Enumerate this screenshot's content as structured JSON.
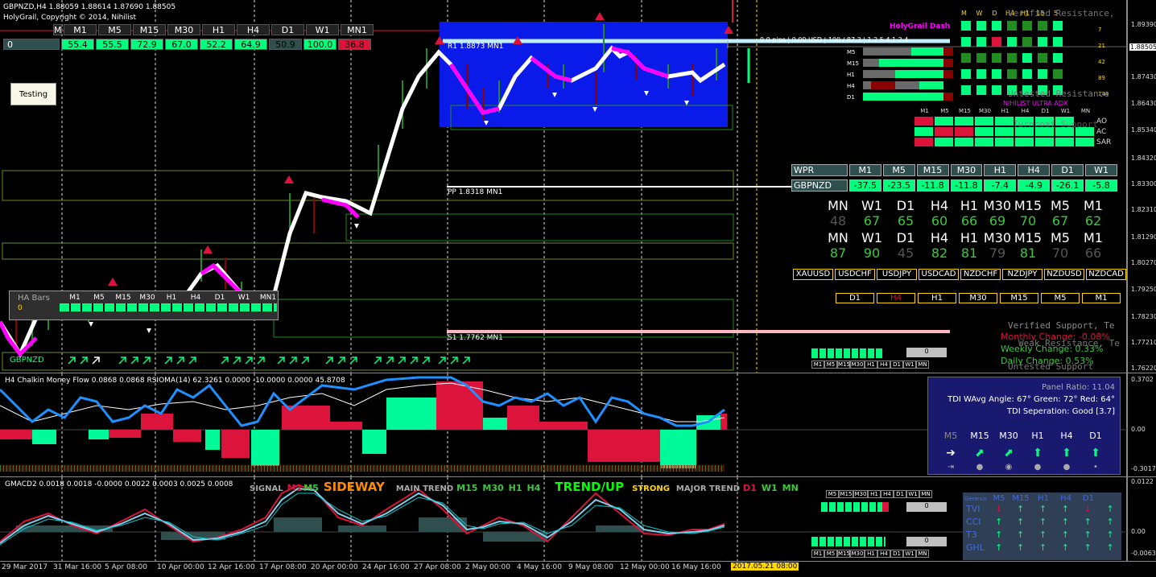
{
  "header": {
    "symbol_line": "GBPNZD,H4  1.88059 1.88614 1.87690 1.88505",
    "copyright": "HolyGrail, Copyright © 2014, Nihilist"
  },
  "tf_labels": [
    "M1",
    "M5",
    "M15",
    "M30",
    "H1",
    "H4",
    "D1",
    "W1",
    "MN1"
  ],
  "tf_bar": {
    "first": "0",
    "values": [
      "55.4",
      "55.5",
      "72.9",
      "67.0",
      "52.2",
      "64.9",
      "50.9",
      "100.0",
      "36.8"
    ]
  },
  "testing_button": "Testing",
  "price_axis": [
    "1.89390",
    "1.88505",
    "1.87430",
    "1.86430",
    "1.85340",
    "1.84320",
    "1.83300",
    "1.82310",
    "1.81290",
    "1.80270",
    "1.79250",
    "1.78230",
    "1.77210",
    "1.76220"
  ],
  "price_highlight": "1.88505",
  "chart_labels": {
    "r1": "R1 1.8873 MN1",
    "pp": "PP 1.8318 MN1",
    "s1": "S1 1.7762 MN1",
    "pips": "0.0 pips | 0.00 USD | 100 / 87.3 | 1.2.5.4.1.2.4"
  },
  "ha": {
    "title": "HA Bars",
    "value": "0",
    "labels": [
      "M1",
      "M5",
      "M15",
      "M30",
      "H1",
      "H4",
      "D1",
      "W1",
      "MN1"
    ]
  },
  "bottom_symbol": "GBPNZD",
  "holygrail": {
    "title": "HolyGrail Dash",
    "cols": [
      "M",
      "W",
      "D",
      "H4",
      "H1",
      "15",
      "5"
    ],
    "rows": [
      "M5",
      "M15",
      "H1",
      "H4",
      "D1"
    ],
    "nums": [
      "7",
      "21",
      "42",
      "89",
      "144"
    ]
  },
  "adx": {
    "title": "NIHILIST ULTRA ADX",
    "cols": [
      "M1",
      "M5",
      "M15",
      "M30",
      "H1",
      "H4",
      "D1",
      "W1",
      "MN"
    ],
    "rows": [
      "AO",
      "AC",
      "SAR"
    ]
  },
  "wpr": {
    "title": "WPR",
    "cols": [
      "M1",
      "M5",
      "M15",
      "M30",
      "H1",
      "H4",
      "D1",
      "W1"
    ],
    "symbol": "GBPNZD",
    "values": [
      "-37.5",
      "-23.5",
      "-11.8",
      "-11.8",
      "-7.4",
      "-4.9",
      "-26.1",
      "-5.8"
    ]
  },
  "strength1": {
    "labels": [
      "MN",
      "W1",
      "D1",
      "H4",
      "H1",
      "M30",
      "M15",
      "M5",
      "M1"
    ],
    "values": [
      "48",
      "67",
      "65",
      "60",
      "66",
      "69",
      "70",
      "67",
      "62"
    ]
  },
  "strength2": {
    "labels": [
      "MN",
      "W1",
      "D1",
      "H4",
      "H1",
      "M30",
      "M15",
      "M5",
      "M1"
    ],
    "values": [
      "87",
      "90",
      "45",
      "82",
      "81",
      "79",
      "81",
      "70",
      "66"
    ]
  },
  "pairs": [
    "XAUUSD",
    "USDCHF",
    "USDJPY",
    "USDCAD",
    "NZDCHF",
    "NZDJPY",
    "NZDUSD",
    "NZDCAD"
  ],
  "tf_buttons": [
    "D1",
    "H4",
    "H1",
    "M30",
    "M15",
    "M5",
    "M1"
  ],
  "ghost": {
    "verified_resistance": "Verified Resistance,",
    "untested_resistance": "Untested Resistance",
    "turncoat_support": "Turncoat Support",
    "verified_support": "Verified Support, Te",
    "weak_resistance": "Weak Resistance, Te",
    "untested_support": "Untested Support"
  },
  "changes": {
    "monthly": "Monthly Change: -0.08%",
    "weekly": "Weekly Change: 0.33%",
    "daily": "Daily Change: 0.53%"
  },
  "mini1": {
    "value": "0",
    "labels": [
      "M1",
      "M5",
      "M15",
      "M30",
      "H1",
      "H4",
      "D1",
      "W1",
      "MN"
    ]
  },
  "cmf": {
    "title": "H4 Chalkin Money Flow 0.0868 0.0868  RSIOMA(14) 62.3261 0.0000 -10.0000 0.0000 45.8708",
    "axis": [
      "0.3702",
      "0.00",
      "-0.3017"
    ]
  },
  "tdi": {
    "ratio": "Panel Ratio: 11.04",
    "angle": "TDI WAvg Angle: 67°  Green: 72°  Red: 64°",
    "separation": "TDI Seperation: Good [3.7]",
    "cols": [
      "M5",
      "M15",
      "M30",
      "H1",
      "H4",
      "D1"
    ]
  },
  "gmacd": {
    "title": "GMACD2 0.0018 0.0018 -0.0000 0.0022 0.0003 0.0025 0.0008",
    "axis": [
      "0.0122",
      "0.00",
      "-0.0063"
    ]
  },
  "signal_line": {
    "signal": "SIGNAL",
    "m1": "M1",
    "m5": "M5",
    "sideway": "SIDEWAY",
    "main": "MAIN TREND",
    "m15": "M15",
    "m30": "M30",
    "h1": "H1",
    "h4": "H4",
    "trendup": "TREND/UP",
    "strong": "STRONG",
    "major": "MAJOR TREND",
    "d1": "D1",
    "w1": "W1",
    "mn": "MN"
  },
  "mini2": {
    "value": "0",
    "labels": [
      "M5",
      "M15",
      "M30",
      "H1",
      "H4",
      "D1",
      "W1",
      "MN"
    ]
  },
  "mini3": {
    "value": "0",
    "labels": [
      "M1",
      "M5",
      "M15",
      "M30",
      "H1",
      "H4",
      "D1",
      "W1",
      "MN"
    ]
  },
  "genesis": {
    "title": "Genesis",
    "cols": [
      "M5",
      "M15",
      "H1",
      "H4",
      "D1",
      "W1"
    ],
    "rows": [
      "TVI",
      "CCI",
      "T3",
      "GHL"
    ]
  },
  "time_axis": [
    "29 Mar 2017",
    "31 Mar 16:00",
    "5 Apr 08:00",
    "10 Apr 00:00",
    "12 Apr 16:00",
    "17 Apr 08:00",
    "20 Apr 00:00",
    "24 Apr 16:00",
    "27 Apr 08:00",
    "2 May 00:00",
    "4 May 16:00",
    "9 May 08:00",
    "12 May 00:00",
    "16 May 16:00"
  ],
  "time_highlight": "2017.05.21 08:00",
  "colors": {
    "green": "#00ff7f",
    "red": "#dc143c",
    "panelblue": "#1a2fb5"
  }
}
